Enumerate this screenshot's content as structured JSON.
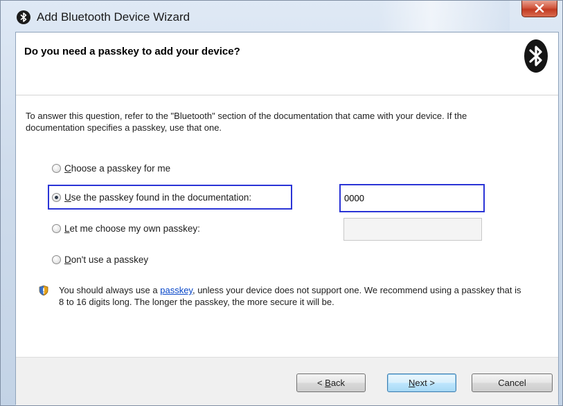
{
  "window": {
    "title": "Add Bluetooth Device Wizard",
    "close_glyph": "x"
  },
  "header": {
    "title": "Do you need a passkey to add your device?",
    "logo_icon": "bluetooth-icon"
  },
  "instructions": "To answer this question, refer to the \"Bluetooth\" section of the documentation that came with your device. If the documentation specifies a passkey, use that one.",
  "options": [
    {
      "label": "Choose a passkey for me",
      "mnemonic": "C",
      "rest": "hoose a passkey for me",
      "checked": false
    },
    {
      "label": "Use the passkey found in the documentation:",
      "mnemonic": "U",
      "rest": "se the passkey found in the documentation:",
      "checked": true
    },
    {
      "label": "Let me choose my own passkey:",
      "mnemonic": "L",
      "rest": "et me choose my own passkey:",
      "checked": false
    },
    {
      "label": "Don't use a passkey",
      "mnemonic": "D",
      "rest": "on't use a passkey",
      "checked": false
    }
  ],
  "documentation_passkey": {
    "value": "0000"
  },
  "own_passkey": {
    "value": ""
  },
  "info": {
    "icon": "security-shield-icon",
    "prefix": "You should always use a ",
    "link": "passkey",
    "suffix": ", unless your device does not support one. We recommend using a passkey that is 8 to 16 digits long. The longer the passkey, the more secure it will be."
  },
  "buttons": {
    "back": {
      "pre": "< ",
      "mnemonic": "B",
      "rest": "ack"
    },
    "next": {
      "mnemonic": "N",
      "rest": "ext >"
    },
    "cancel": "Cancel"
  },
  "colors": {
    "focus_border": "#2a34d6",
    "link": "#0645c8",
    "close_button": "#c23a21"
  }
}
